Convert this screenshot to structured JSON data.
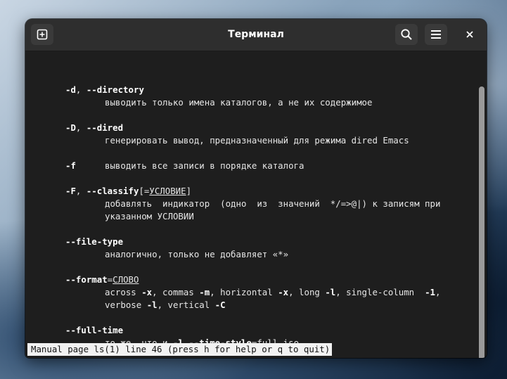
{
  "window": {
    "title": "Терминал"
  },
  "headerbar": {
    "icons": [
      "new-tab-icon",
      "search-icon",
      "menu-icon",
      "close-icon"
    ],
    "close_glyph": "×"
  },
  "terminal": {
    "d_opt_short": "-d",
    "d_sep": ", ",
    "d_opt_long": "--directory",
    "d_desc": "выводить только имена каталогов, а не их содержимое",
    "D_opt_short": "-D",
    "D_sep": ", ",
    "D_opt_long": "--dired",
    "D_desc": "генерировать вывод, предназначенный для режима dired Emacs",
    "f_opt": "-f",
    "f_desc": "выводить все записи в порядке каталога",
    "F_opt_short": "-F",
    "F_sep": ", ",
    "F_opt_long": "--classify",
    "F_bracket_open": "[=",
    "F_arg": "УСЛОВИЕ",
    "F_bracket_close": "]",
    "F_desc_1": "добавлять  индикатор  (одно  из  значений  */=>@|) к записям при",
    "F_desc_2": "указанном УСЛОВИИ",
    "ft_opt": "--file-type",
    "ft_desc": "аналогично, только не добавляет «*»",
    "fmt_opt": "--format",
    "fmt_eq": "=",
    "fmt_arg": "СЛОВО",
    "fmt_l1_a": "across ",
    "fmt_l1_b": "-x",
    "fmt_l1_c": ", commas ",
    "fmt_l1_d": "-m",
    "fmt_l1_e": ", horizontal ",
    "fmt_l1_f": "-x",
    "fmt_l1_g": ", long ",
    "fmt_l1_h": "-l",
    "fmt_l1_i": ", single-column  ",
    "fmt_l1_j": "-1",
    "fmt_l1_k": ",",
    "fmt_l2_a": "verbose ",
    "fmt_l2_b": "-l",
    "fmt_l2_c": ", vertical ",
    "fmt_l2_d": "-C",
    "fullt_opt": "--full-time",
    "fullt_a": "то же, что и ",
    "fullt_b": "-l",
    "fullt_c": " ",
    "fullt_d": "--time-style",
    "fullt_e": "=",
    "fullt_f": "full-iso"
  },
  "status_bar": {
    "text": "Manual page ls(1) line 46 (press h for help or q to quit)"
  },
  "colors": {
    "terminal_bg": "#1e1e1e",
    "headerbar_bg": "#2e2e2e",
    "text": "#e6e6e6",
    "status_bg": "#f2f2f2"
  }
}
